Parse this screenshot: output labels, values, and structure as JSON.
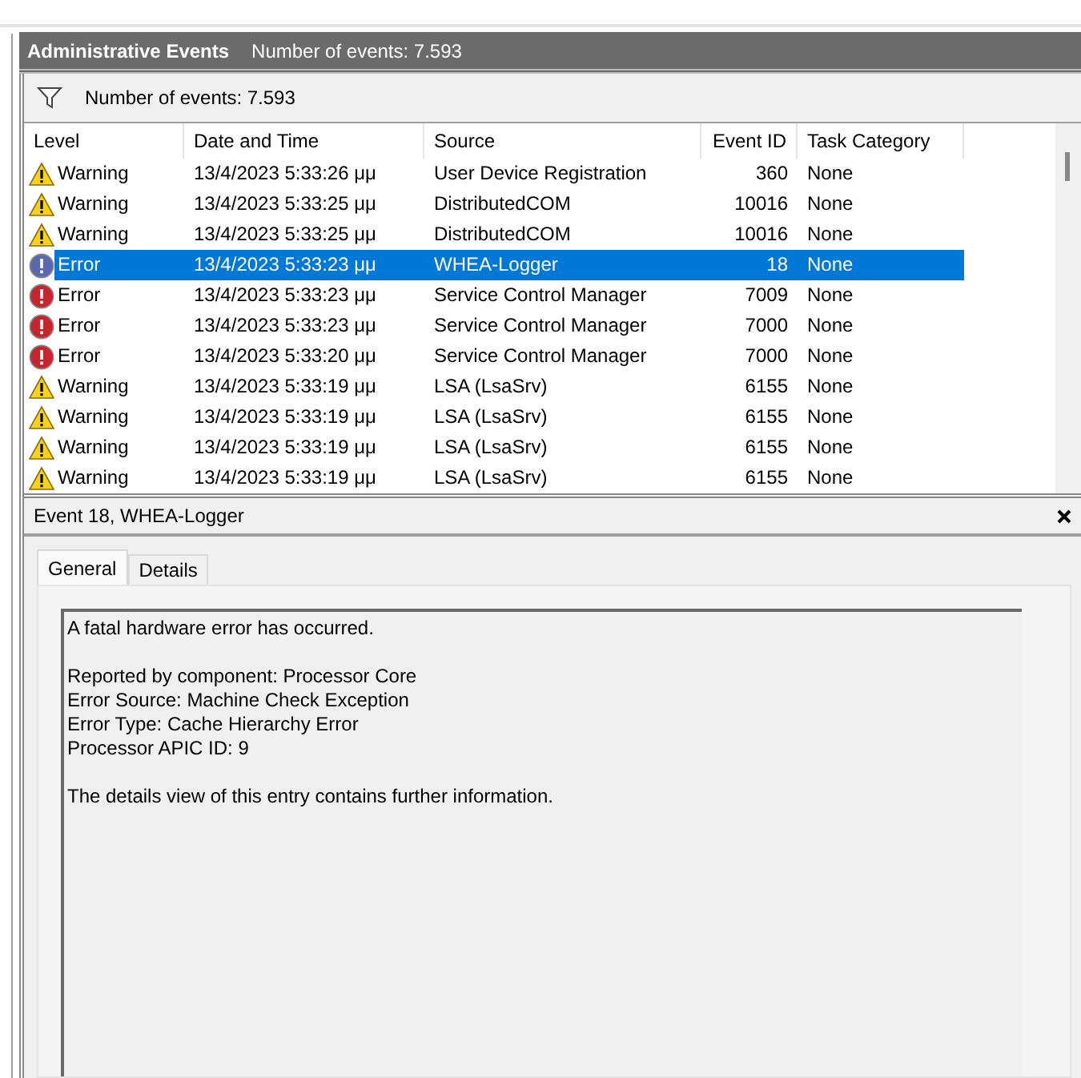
{
  "header": {
    "title": "Administrative Events",
    "count": "Number of events: 7.593"
  },
  "toolbar": {
    "count": "Number of events: 7.593"
  },
  "table": {
    "columns": [
      "Level",
      "Date and Time",
      "Source",
      "Event ID",
      "Task Category"
    ],
    "rows": [
      {
        "kind": "warning",
        "level": "Warning",
        "date": "13/4/2023 5:33:26 μμ",
        "source": "User Device Registration",
        "event_id": "360",
        "category": "None",
        "selected": false
      },
      {
        "kind": "warning",
        "level": "Warning",
        "date": "13/4/2023 5:33:25 μμ",
        "source": "DistributedCOM",
        "event_id": "10016",
        "category": "None",
        "selected": false
      },
      {
        "kind": "warning",
        "level": "Warning",
        "date": "13/4/2023 5:33:25 μμ",
        "source": "DistributedCOM",
        "event_id": "10016",
        "category": "None",
        "selected": false
      },
      {
        "kind": "error",
        "level": "Error",
        "date": "13/4/2023 5:33:23 μμ",
        "source": "WHEA-Logger",
        "event_id": "18",
        "category": "None",
        "selected": true
      },
      {
        "kind": "error",
        "level": "Error",
        "date": "13/4/2023 5:33:23 μμ",
        "source": "Service Control Manager",
        "event_id": "7009",
        "category": "None",
        "selected": false
      },
      {
        "kind": "error",
        "level": "Error",
        "date": "13/4/2023 5:33:23 μμ",
        "source": "Service Control Manager",
        "event_id": "7000",
        "category": "None",
        "selected": false
      },
      {
        "kind": "error",
        "level": "Error",
        "date": "13/4/2023 5:33:20 μμ",
        "source": "Service Control Manager",
        "event_id": "7000",
        "category": "None",
        "selected": false
      },
      {
        "kind": "warning",
        "level": "Warning",
        "date": "13/4/2023 5:33:19 μμ",
        "source": "LSA (LsaSrv)",
        "event_id": "6155",
        "category": "None",
        "selected": false
      },
      {
        "kind": "warning",
        "level": "Warning",
        "date": "13/4/2023 5:33:19 μμ",
        "source": "LSA (LsaSrv)",
        "event_id": "6155",
        "category": "None",
        "selected": false
      },
      {
        "kind": "warning",
        "level": "Warning",
        "date": "13/4/2023 5:33:19 μμ",
        "source": "LSA (LsaSrv)",
        "event_id": "6155",
        "category": "None",
        "selected": false
      },
      {
        "kind": "warning",
        "level": "Warning",
        "date": "13/4/2023 5:33:19 μμ",
        "source": "LSA (LsaSrv)",
        "event_id": "6155",
        "category": "None",
        "selected": false
      }
    ]
  },
  "details": {
    "title": "Event 18, WHEA-Logger",
    "tabs": [
      {
        "label": "General",
        "selected": true
      },
      {
        "label": "Details",
        "selected": false
      }
    ],
    "paragraphs": [
      [
        "A fatal hardware error has occurred."
      ],
      [
        "Reported by component: Processor Core",
        "Error Source: Machine Check Exception",
        "Error Type: Cache Hierarchy Error",
        "Processor APIC ID: 9"
      ],
      [
        "The details view of this entry contains further information."
      ]
    ]
  }
}
